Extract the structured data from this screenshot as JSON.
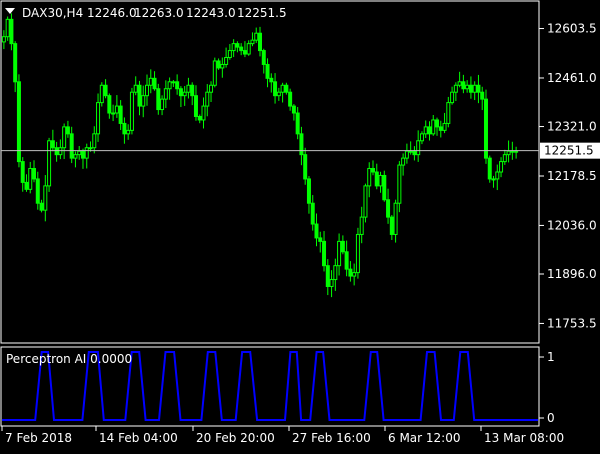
{
  "window": {
    "symbol_header": "DAX30,H4",
    "ohlc": [
      "12246.0",
      "12263.0",
      "12243.0",
      "12251.5"
    ]
  },
  "colors": {
    "background": "#000000",
    "frame": "#ffffff",
    "text": "#ffffff",
    "candle": "#00ff00",
    "bid_line": "#c0c0c0",
    "bid_label_bg": "#ffffff",
    "bid_label_text": "#000000",
    "indicator_line": "#0000ff"
  },
  "chart_data": [
    {
      "type": "candlestick",
      "symbol": "DAX30",
      "timeframe": "H4",
      "last_quote": {
        "open": 12246.0,
        "high": 12263.0,
        "low": 12243.0,
        "close": 12251.5
      },
      "current_price_label": "12251.5",
      "current_price": 12251.5,
      "ylim": [
        11700,
        12680
      ],
      "y_ticks": [
        "12603.5",
        "12461.0",
        "12321.0",
        "12178.5",
        "12036.0",
        "11896.0",
        "11753.5"
      ],
      "x_ticks": [
        "7 Feb 2018",
        "14 Feb 04:00",
        "20 Feb 20:00",
        "27 Feb 16:00",
        "6 Mar 12:00",
        "13 Mar 08:00"
      ],
      "grid": false,
      "closes": [
        12580,
        12630,
        12560,
        12450,
        12220,
        12160,
        12140,
        12200,
        12170,
        12100,
        12080,
        12150,
        12280,
        12260,
        12240,
        12260,
        12320,
        12300,
        12230,
        12240,
        12250,
        12230,
        12260,
        12260,
        12300,
        12390,
        12440,
        12410,
        12360,
        12360,
        12380,
        12330,
        12300,
        12310,
        12420,
        12440,
        12380,
        12410,
        12440,
        12460,
        12430,
        12370,
        12400,
        12430,
        12450,
        12450,
        12430,
        12410,
        12420,
        12440,
        12410,
        12350,
        12340,
        12380,
        12420,
        12440,
        12510,
        12490,
        12500,
        12520,
        12540,
        12560,
        12550,
        12540,
        12530,
        12560,
        12570,
        12590,
        12540,
        12500,
        12460,
        12450,
        12410,
        12420,
        12440,
        12420,
        12380,
        12360,
        12300,
        12240,
        12170,
        12100,
        12040,
        12000,
        11990,
        11920,
        11860,
        11880,
        11920,
        11990,
        11960,
        11910,
        11890,
        11900,
        12010,
        12060,
        12150,
        12200,
        12190,
        12150,
        12180,
        12110,
        12060,
        12010,
        12100,
        12210,
        12230,
        12250,
        12250,
        12240,
        12280,
        12300,
        12320,
        12300,
        12340,
        12320,
        12310,
        12330,
        12390,
        12420,
        12440,
        12450,
        12430,
        12440,
        12420,
        12440,
        12420,
        12400,
        12230,
        12170,
        12170,
        12190,
        12220,
        12240,
        12250,
        12250,
        12250
      ]
    },
    {
      "type": "line",
      "title": "Perceptron AI 0.0000",
      "indicator_value": "0.0000",
      "ylim": [
        0,
        1
      ],
      "y_ticks": [
        "1",
        "0"
      ],
      "segments": [
        [
          0.0,
          0
        ],
        [
          0.062,
          0
        ],
        [
          0.074,
          1
        ],
        [
          0.086,
          1
        ],
        [
          0.097,
          0
        ],
        [
          0.15,
          0
        ],
        [
          0.162,
          1
        ],
        [
          0.179,
          1
        ],
        [
          0.19,
          0
        ],
        [
          0.23,
          0
        ],
        [
          0.242,
          1
        ],
        [
          0.256,
          1
        ],
        [
          0.268,
          0
        ],
        [
          0.293,
          0
        ],
        [
          0.305,
          1
        ],
        [
          0.321,
          1
        ],
        [
          0.333,
          0
        ],
        [
          0.372,
          0
        ],
        [
          0.384,
          1
        ],
        [
          0.398,
          1
        ],
        [
          0.41,
          0
        ],
        [
          0.436,
          0
        ],
        [
          0.448,
          1
        ],
        [
          0.463,
          1
        ],
        [
          0.476,
          0
        ],
        [
          0.528,
          0
        ],
        [
          0.538,
          1
        ],
        [
          0.55,
          1
        ],
        [
          0.558,
          0
        ],
        [
          0.575,
          0
        ],
        [
          0.587,
          1
        ],
        [
          0.599,
          1
        ],
        [
          0.611,
          0
        ],
        [
          0.676,
          0
        ],
        [
          0.688,
          1
        ],
        [
          0.7,
          1
        ],
        [
          0.712,
          0
        ],
        [
          0.781,
          0
        ],
        [
          0.793,
          1
        ],
        [
          0.807,
          1
        ],
        [
          0.819,
          0
        ],
        [
          0.843,
          0
        ],
        [
          0.855,
          1
        ],
        [
          0.869,
          1
        ],
        [
          0.881,
          0
        ],
        [
          1.0,
          0
        ]
      ]
    }
  ]
}
